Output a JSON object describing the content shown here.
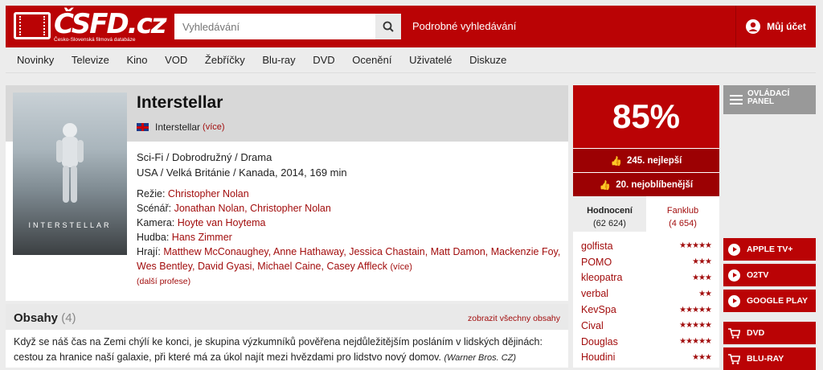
{
  "header": {
    "logo_text": "ČSFD.cz",
    "logo_subtitle": "Česko-Slovenská filmová databáze",
    "search_placeholder": "Vyhledávání",
    "advanced_search": "Podrobné vyhledávání",
    "account_label": "Můj účet",
    "brand_color": "#ba0305"
  },
  "nav": {
    "items": [
      "Novinky",
      "Televize",
      "Kino",
      "VOD",
      "Žebříčky",
      "Blu-ray",
      "DVD",
      "Ocenění",
      "Uživatelé",
      "Diskuze"
    ]
  },
  "movie": {
    "title": "Interstellar",
    "poster_title": "INTERSTELLAR",
    "original_title": "Interstellar",
    "original_more": "(více)",
    "genres": "Sci-Fi / Dobrodružný / Drama",
    "origin": "USA / Velká Británie / Kanada, 2014, 169 min",
    "director_label": "Režie:",
    "director": "Christopher Nolan",
    "writers_label": "Scénář:",
    "writers": "Jonathan Nolan, Christopher Nolan",
    "camera_label": "Kamera:",
    "camera": "Hoyte van Hoytema",
    "music_label": "Hudba:",
    "music": "Hans Zimmer",
    "cast_label": "Hrají:",
    "cast": "Matthew McConaughey, Anne Hathaway, Jessica Chastain, Matt Damon, Mackenzie Foy, Wes Bentley, David Gyasi, Michael Caine, Casey Affleck",
    "cast_more": "(více)",
    "more_professions": "(další profese)"
  },
  "plot": {
    "title": "Obsahy",
    "count": "(4)",
    "show_all": "zobrazit všechny obsahy",
    "text": "Když se náš čas na Zemi chýlí ke konci, je skupina výzkumníků pověřena nejdůležitějším posláním v lidských dějinách: cestou za hranice naší galaxie, při které má za úkol najít mezi hvězdami pro lidstvo nový domov.",
    "source": "(Warner Bros. CZ)"
  },
  "rating": {
    "percent": "85%",
    "best_rank": "245. nejlepší",
    "favorite_rank": "20. nejoblíbenější",
    "tab_ratings_label": "Hodnocení",
    "tab_ratings_count": "(62 624)",
    "tab_fanclub_label": "Fanklub",
    "tab_fanclub_count": "(4 654)",
    "users": [
      {
        "name": "golfista",
        "stars": "★★★★★"
      },
      {
        "name": "POMO",
        "stars": "★★★"
      },
      {
        "name": "kleopatra",
        "stars": "★★★"
      },
      {
        "name": "verbal",
        "stars": "★★"
      },
      {
        "name": "KevSpa",
        "stars": "★★★★★"
      },
      {
        "name": "Cival",
        "stars": "★★★★★"
      },
      {
        "name": "Douglas",
        "stars": "★★★★★"
      },
      {
        "name": "Houdini",
        "stars": "★★★"
      }
    ]
  },
  "side": {
    "control_panel": "OVLÁDACÍ PANEL",
    "streams": [
      "APPLE TV+",
      "O2TV",
      "GOOGLE PLAY"
    ],
    "shop": [
      "DVD",
      "BLU-RAY"
    ]
  }
}
